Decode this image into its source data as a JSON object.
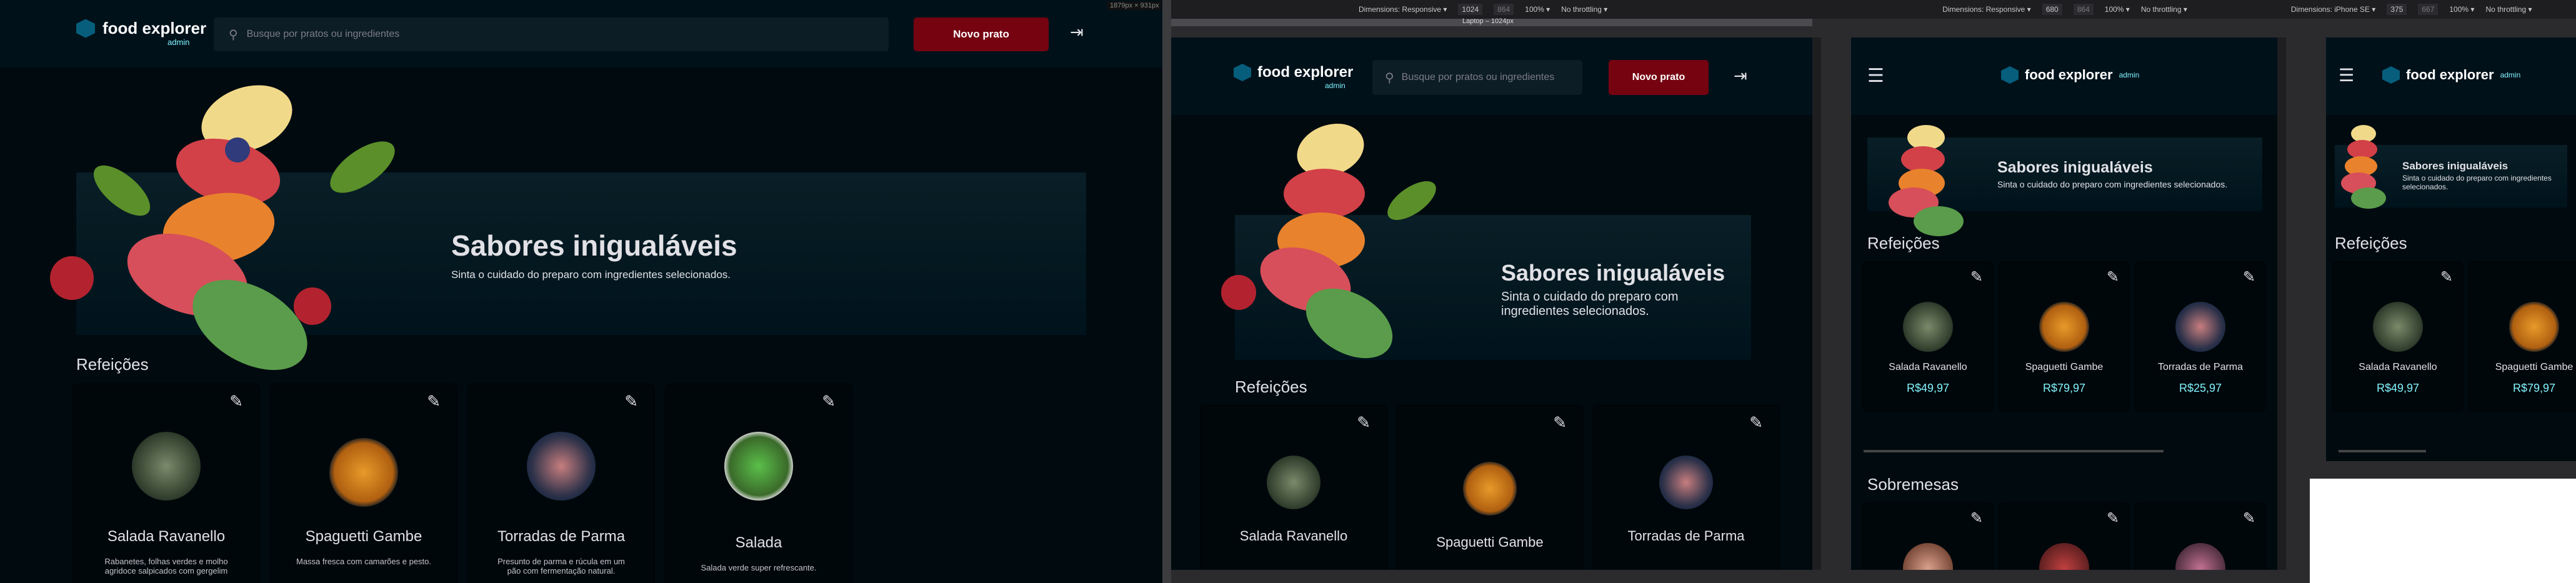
{
  "app": {
    "logo_text": "food explorer",
    "logo_sub": "admin",
    "search_placeholder": "Busque por pratos ou ingredientes",
    "new_dish_button": "Novo prato",
    "banner_title": "Sabores inigualáveis",
    "banner_subtitle": "Sinta o cuidado do preparo com ingredientes selecionados.",
    "section_meals": "Refeições",
    "section_desserts": "Sobremesas"
  },
  "dishes": [
    {
      "name": "Salada Ravanello",
      "desc": "Rabanetes, folhas verdes e molho agridoce salpicados com gergelim",
      "price": "R$49,97"
    },
    {
      "name": "Spaguetti Gambe",
      "desc": "Massa fresca com camarões e pesto.",
      "price": "R$79,97"
    },
    {
      "name": "Torradas de Parma",
      "desc": "Presunto de parma e rúcula em um pão com fermentação natural.",
      "price": "R$25,97"
    },
    {
      "name": "Salada",
      "desc": "Salada verde super refrescante.",
      "price": ""
    }
  ],
  "devtools": {
    "size_readout": "1879px × 931px",
    "laptop_label": "Laptop – 1024px",
    "p1": {
      "dim_label": "Dimensions: Responsive ▾",
      "w": "1024",
      "h": "864",
      "zoom": "100% ▾",
      "throttle": "No throttling ▾"
    },
    "p2": {
      "dim_label": "Dimensions: Responsive ▾",
      "w": "680",
      "h": "864",
      "zoom": "100% ▾",
      "throttle": "No throttling ▾"
    },
    "p3": {
      "dim_label": "Dimensions: iPhone SE ▾",
      "w": "375",
      "h": "667",
      "zoom": "100% ▾",
      "throttle": "No throttling ▾"
    }
  },
  "colors": {
    "accent_red": "#750310",
    "price_cyan": "#82f3ff",
    "bg_dark": "#000a0f",
    "header": "#00111a"
  }
}
